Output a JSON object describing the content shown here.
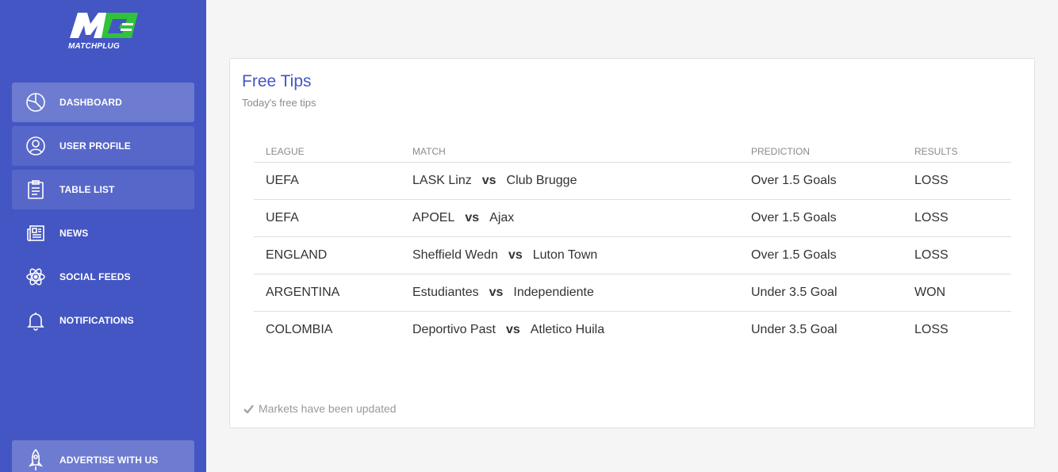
{
  "brand": {
    "name": "MATCHPLUG",
    "accent": "#30c23a",
    "sidebar_color": "#4456c3"
  },
  "nav": [
    {
      "label": "DASHBOARD",
      "icon": "pie-chart-icon",
      "active": true
    },
    {
      "label": "USER PROFILE",
      "icon": "user-icon"
    },
    {
      "label": "TABLE LIST",
      "icon": "clipboard-icon"
    },
    {
      "label": "NEWS",
      "icon": "newspaper-icon"
    },
    {
      "label": "SOCIAL FEEDS",
      "icon": "atom-icon"
    },
    {
      "label": "NOTIFICATIONS",
      "icon": "bell-icon"
    }
  ],
  "advertise": {
    "label": "ADVERTISE WITH US",
    "icon": "rocket-icon"
  },
  "card": {
    "title": "Free Tips",
    "subtitle": "Today's free tips",
    "headers": [
      "LEAGUE",
      "MATCH",
      "PREDICTION",
      "RESULTS"
    ],
    "vs_label": "vs",
    "rows": [
      {
        "league": "UEFA",
        "home": "LASK Linz",
        "away": "Club Brugge",
        "prediction": "Over 1.5 Goals",
        "result": "LOSS"
      },
      {
        "league": "UEFA",
        "home": "APOEL",
        "away": "Ajax",
        "prediction": "Over 1.5 Goals",
        "result": "LOSS"
      },
      {
        "league": "ENGLAND",
        "home": "Sheffield Wedn",
        "away": "Luton Town",
        "prediction": "Over 1.5 Goals",
        "result": "LOSS"
      },
      {
        "league": "ARGENTINA",
        "home": "Estudiantes",
        "away": "Independiente",
        "prediction": "Under 3.5 Goal",
        "result": "WON"
      },
      {
        "league": "COLOMBIA",
        "home": "Deportivo Past",
        "away": "Atletico Huila",
        "prediction": "Under 3.5 Goal",
        "result": "LOSS"
      }
    ],
    "footer": "Markets have been updated",
    "footer_icon": "check-icon"
  }
}
